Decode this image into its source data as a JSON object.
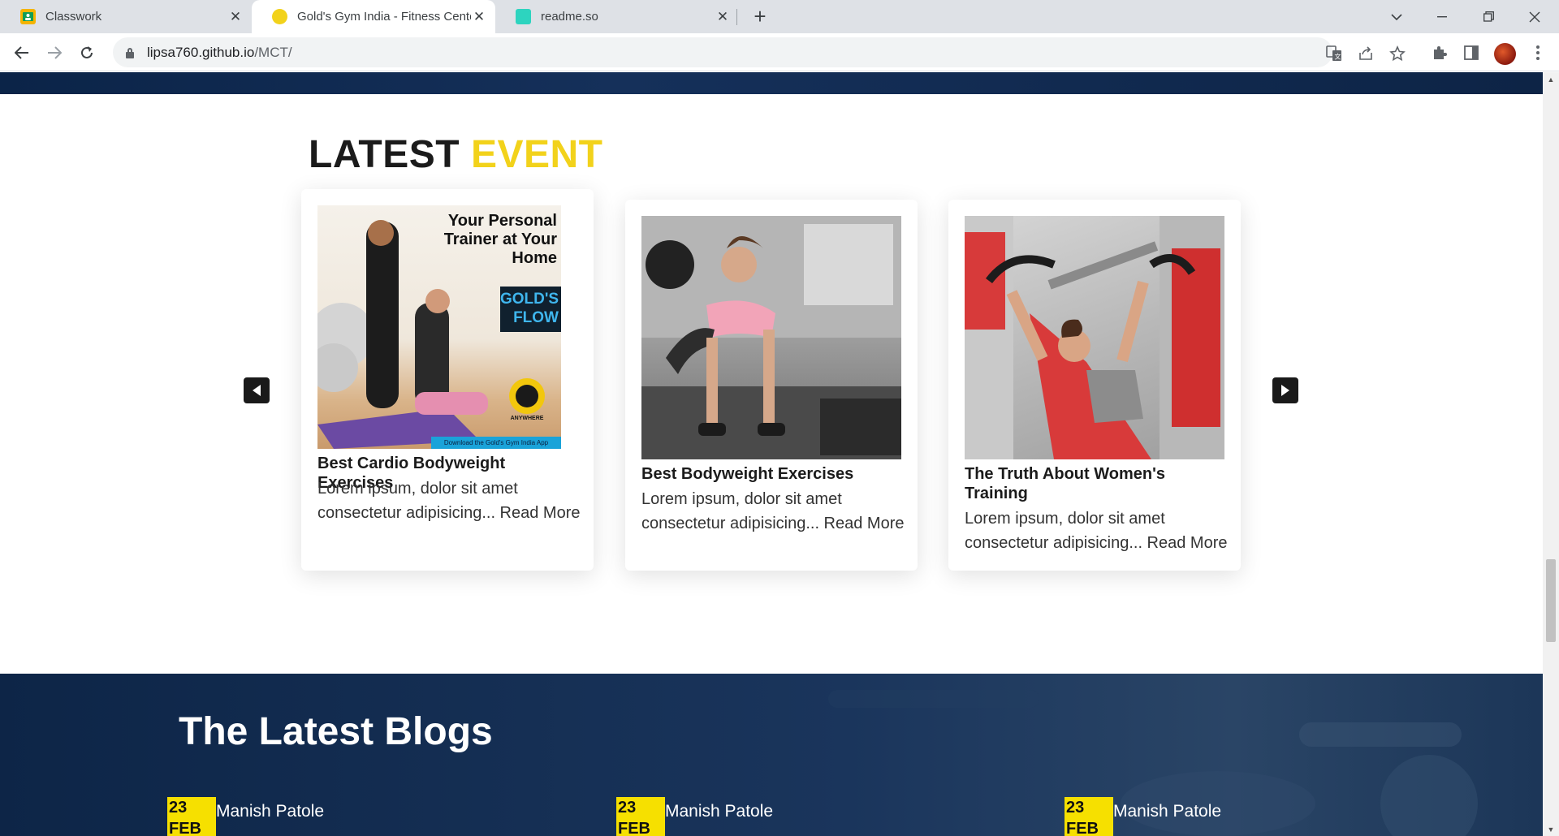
{
  "browser": {
    "tabs": [
      {
        "title": "Classwork",
        "favicon": "classroom-icon",
        "color": "#f4b400"
      },
      {
        "title": "Gold's Gym India - Fitness Center",
        "favicon": "golds-gym-icon",
        "color": "#f2d21b"
      },
      {
        "title": "readme.so",
        "favicon": "readme-icon",
        "color": "#2dd4bf"
      }
    ],
    "url_host": "lipsa760.github.io",
    "url_path": "/MCT/"
  },
  "events": {
    "heading_main": "LATEST",
    "heading_accent": "EVENT",
    "accent_color": "#f2d21b",
    "cards": [
      {
        "title": "Best Cardio Bodyweight Exercises",
        "text": "Lorem ipsum, dolor sit amet consectetur adipisicing... Read More",
        "image_text": {
          "headline": "Your Personal Trainer at Your Home",
          "badge": "GOLD'S FLOW",
          "logo_caption": "ANYWHERE",
          "footer": "Download the Gold's Gym India App"
        }
      },
      {
        "title": "Best Bodyweight Exercises",
        "text": "Lorem ipsum, dolor sit amet consectetur adipisicing... Read More"
      },
      {
        "title": "The Truth About Women's Training",
        "text": "Lorem ipsum, dolor sit amet consectetur adipisicing... Read More"
      }
    ]
  },
  "blogs": {
    "title": "The Latest Blogs",
    "posts": [
      {
        "date": "23 FEB",
        "author": "Manish Patole"
      },
      {
        "date": "23 FEB",
        "author": "Manish Patole"
      },
      {
        "date": "23 FEB",
        "author": "Manish Patole"
      }
    ]
  }
}
